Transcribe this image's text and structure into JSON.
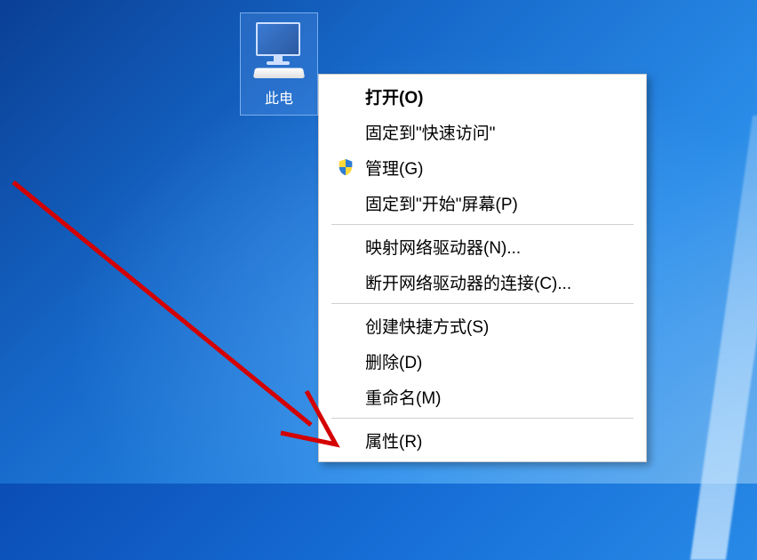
{
  "desktop_icon": {
    "label": "此电"
  },
  "menu": {
    "groups": [
      [
        {
          "label": "打开(O)",
          "bold": true
        },
        {
          "label": "固定到\"快速访问\""
        },
        {
          "label": "管理(G)",
          "hasShield": true
        },
        {
          "label": "固定到\"开始\"屏幕(P)"
        }
      ],
      [
        {
          "label": "映射网络驱动器(N)..."
        },
        {
          "label": "断开网络驱动器的连接(C)..."
        }
      ],
      [
        {
          "label": "创建快捷方式(S)"
        },
        {
          "label": "删除(D)"
        },
        {
          "label": "重命名(M)"
        }
      ],
      [
        {
          "label": "属性(R)"
        }
      ]
    ]
  }
}
